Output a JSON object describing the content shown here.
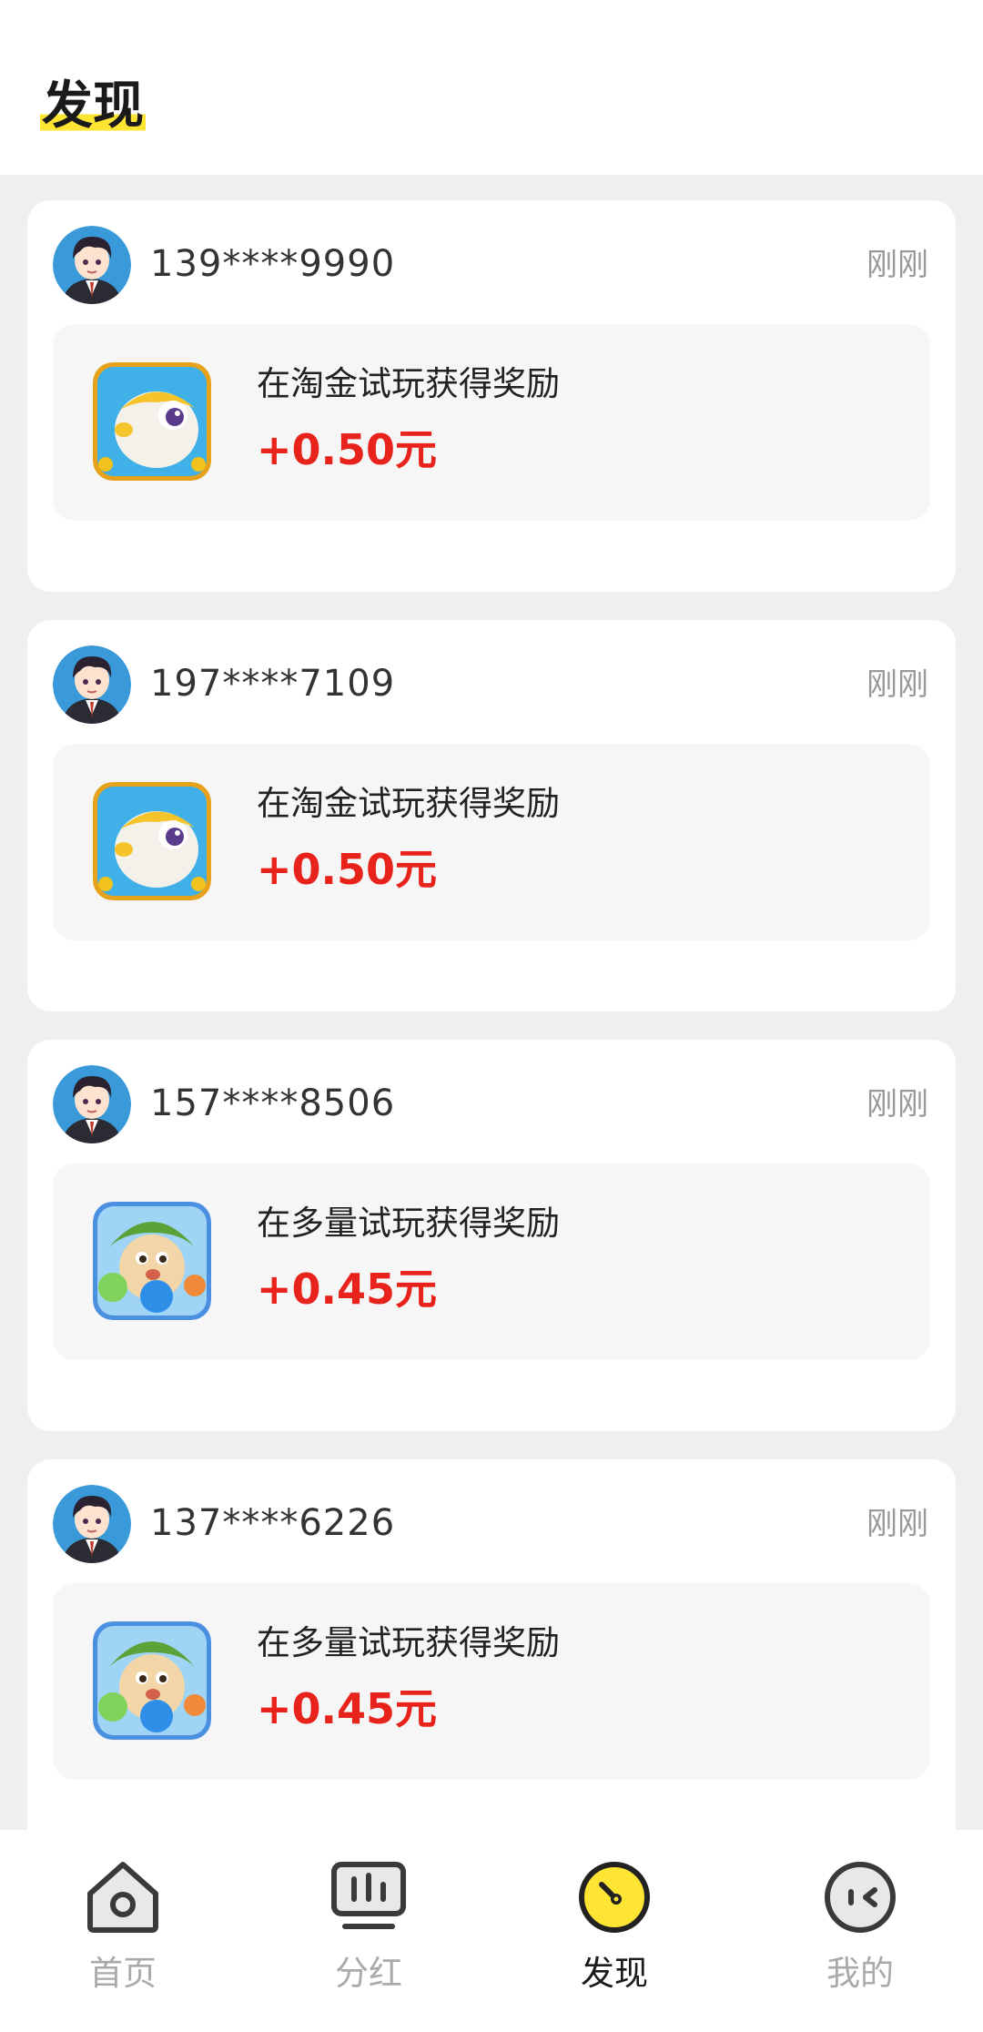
{
  "header": {
    "title": "发现"
  },
  "feed": {
    "items": [
      {
        "phone": "139****9990",
        "time": "刚刚",
        "description": "在淘金试玩获得奖励",
        "amount": "+0.50元",
        "game_icon": "pufferfish-game-icon"
      },
      {
        "phone": "197****7109",
        "time": "刚刚",
        "description": "在淘金试玩获得奖励",
        "amount": "+0.50元",
        "game_icon": "pufferfish-game-icon"
      },
      {
        "phone": "157****8506",
        "time": "刚刚",
        "description": "在多量试玩获得奖励",
        "amount": "+0.45元",
        "game_icon": "bubble-monster-game-icon"
      },
      {
        "phone": "137****6226",
        "time": "刚刚",
        "description": "在多量试玩获得奖励",
        "amount": "+0.45元",
        "game_icon": "bubble-monster-game-icon"
      }
    ]
  },
  "tabbar": {
    "tabs": [
      {
        "label": "首页",
        "icon": "home-icon",
        "active": false
      },
      {
        "label": "分红",
        "icon": "dividend-icon",
        "active": false
      },
      {
        "label": "发现",
        "icon": "discover-icon",
        "active": true
      },
      {
        "label": "我的",
        "icon": "profile-icon",
        "active": false
      }
    ]
  },
  "colors": {
    "accent_yellow": "#ffe533",
    "reward_red": "#e8231b",
    "card_bg": "#ffffff",
    "page_bg": "#efefef",
    "reward_box_bg": "#f6f6f6"
  }
}
